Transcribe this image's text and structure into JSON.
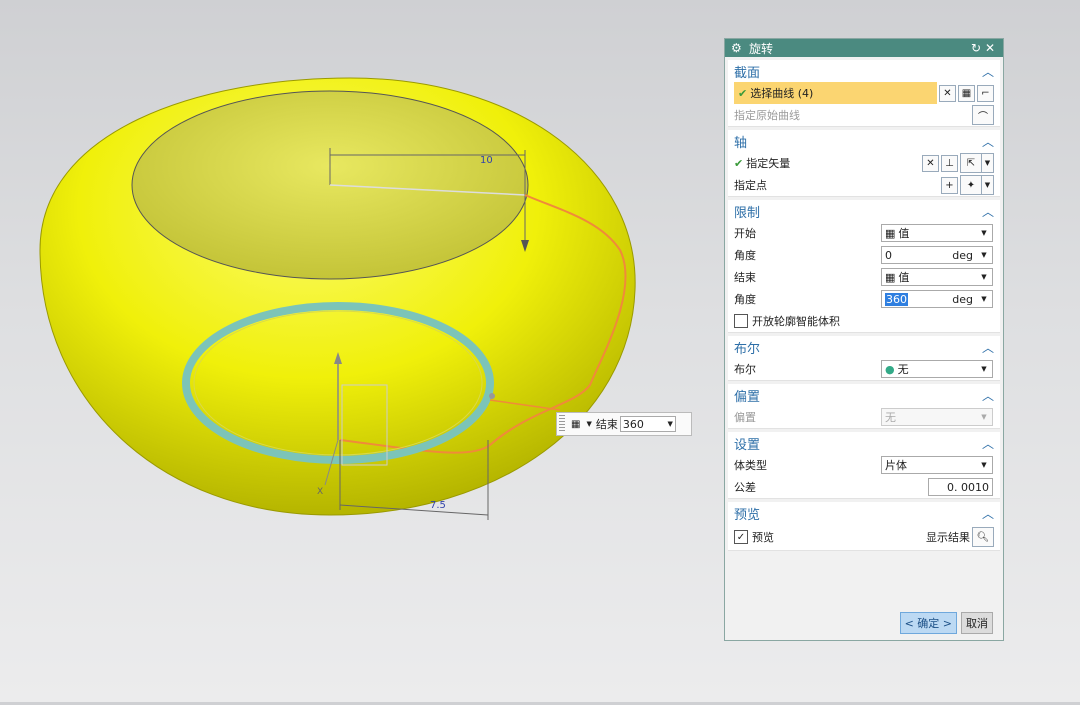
{
  "dialog": {
    "title": "旋转",
    "sections": {
      "section": {
        "header": "截面",
        "select_curve": "选择曲线 (4)",
        "specify_original_curve": "指定原始曲线"
      },
      "axis": {
        "header": "轴",
        "specify_vector": "指定矢量",
        "specify_point": "指定点"
      },
      "limits": {
        "header": "限制",
        "start_label": "开始",
        "start_value": "值",
        "start_angle_label": "角度",
        "start_angle": "0",
        "end_label": "结束",
        "end_value": "值",
        "end_angle_label": "角度",
        "end_angle": "360",
        "unit": "deg",
        "open_profile": "开放轮廓智能体积"
      },
      "boolean": {
        "header": "布尔",
        "label": "布尔",
        "value": "无"
      },
      "offset": {
        "header": "偏置",
        "label": "偏置",
        "value": "无"
      },
      "settings": {
        "header": "设置",
        "body_type_label": "体类型",
        "body_type": "片体",
        "tolerance_label": "公差",
        "tolerance": "0. 0010"
      },
      "preview": {
        "header": "预览",
        "preview_label": "预览",
        "show_result": "显示结果"
      }
    },
    "ok": "< 确定 >",
    "cancel": "取消"
  },
  "float_input": {
    "label": "结束",
    "value": "360"
  },
  "viewport": {
    "dim_top": "10",
    "dim_bottom": "7.5",
    "axis_x": "X"
  },
  "colors": {
    "title_bar": "#4b8a80",
    "section_header": "#2e6fa8",
    "highlight_row": "#fbd571",
    "body_yellow": "#f2f20a",
    "selection_ring": "#7cc4b8"
  }
}
